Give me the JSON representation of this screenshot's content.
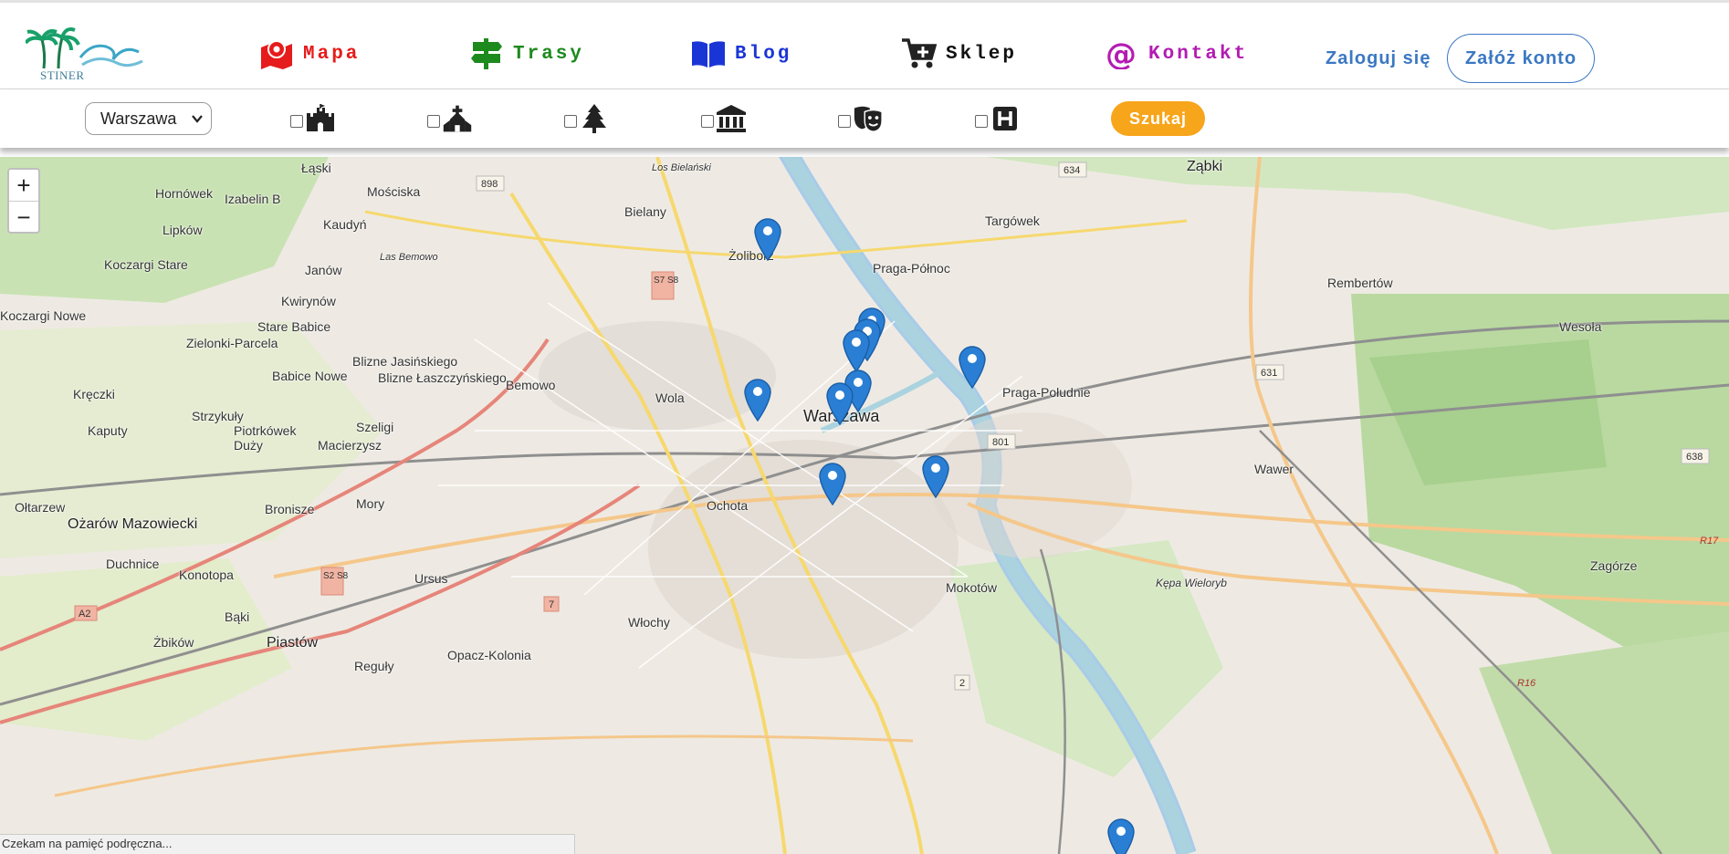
{
  "header": {
    "logo_text": "STINER",
    "nav": [
      {
        "label": "Mapa",
        "color": "#e61b1b",
        "icon": "map-pin-icon"
      },
      {
        "label": "Trasy",
        "color": "#1d8a1d",
        "icon": "signpost-icon"
      },
      {
        "label": "Blog",
        "color": "#1a35d6",
        "icon": "open-book-icon"
      },
      {
        "label": "Sklep",
        "color": "#111111",
        "icon": "cart-plus-icon"
      },
      {
        "label": "Kontakt",
        "color": "#b31cb3",
        "icon": "at-sign-icon"
      }
    ],
    "login_label": "Zaloguj się",
    "register_label": "Załóż konto"
  },
  "filters": {
    "city": "Warszawa",
    "categories": [
      {
        "icon": "castle-icon",
        "checked": false
      },
      {
        "icon": "church-icon",
        "checked": false
      },
      {
        "icon": "tree-icon",
        "checked": false
      },
      {
        "icon": "museum-icon",
        "checked": false
      },
      {
        "icon": "theater-masks-icon",
        "checked": false
      },
      {
        "icon": "hotel-icon",
        "checked": false
      }
    ],
    "search_label": "Szukaj",
    "accent_color": "#f7a51b"
  },
  "map": {
    "zoom_in": "+",
    "zoom_out": "−",
    "labels": [
      "Łąski",
      "Hornówek",
      "Izabelin B",
      "Mościska",
      "Bielany",
      "Los Bielański",
      "Ząbki",
      "Targówek",
      "Żoliborz",
      "Praga-Północ",
      "Rembertów",
      "Wesoła",
      "Lipków",
      "Kaudyń",
      "Koczargi Stare",
      "Janów",
      "Las Bemowo",
      "Kwirynów",
      "Koczargi Nowe",
      "Stare Babice",
      "Zielonki-Parcela",
      "Blizne Jasińskiego",
      "Babice Nowe",
      "Blizne Łaszczyńskiego",
      "Bemowo",
      "Wola",
      "Warszawa",
      "Praga-Południe",
      "Wawer",
      "Kręczki",
      "Strzykuły",
      "Kaputy",
      "Piotrkówek Duży",
      "Szeligi",
      "Macierzysz",
      "Ołtarzew",
      "Bronisze",
      "Mory",
      "Ochota",
      "Ożarów Mazowiecki",
      "Duchnice",
      "Konotopa",
      "Ursus",
      "Mokotów",
      "Kępa Wieloryb",
      "Zagórze",
      "Bąki",
      "Żbików",
      "Piastów",
      "Włochy",
      "Opacz-Kolonia",
      "Reguły"
    ],
    "road_numbers": [
      "898",
      "634",
      "S7 S8",
      "631",
      "801",
      "638",
      "S2 S8",
      "7",
      "A2",
      "2",
      "R17",
      "R16"
    ],
    "marker_color": "#2a7fd4",
    "marker_count": 13
  },
  "status_text": "Czekam na pamięć podręczna..."
}
